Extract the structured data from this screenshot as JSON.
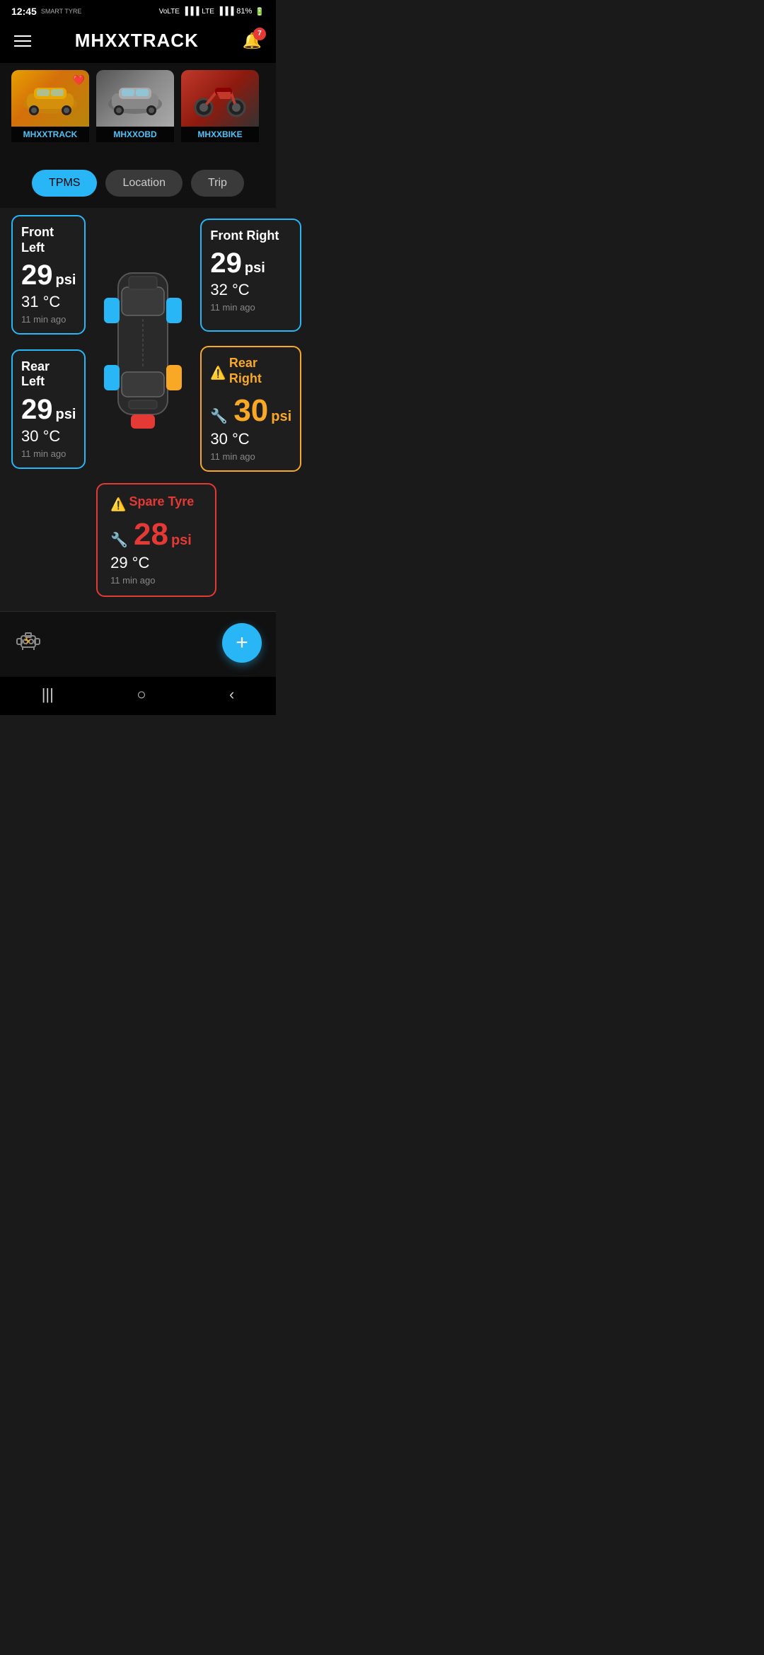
{
  "statusBar": {
    "time": "12:45",
    "brand": "SMART TYRE",
    "signal1": "VoLTE1",
    "signal2": "VoLTE2",
    "battery": "81%"
  },
  "header": {
    "title": "MHXXTRACK",
    "notificationCount": "7"
  },
  "vehicles": [
    {
      "id": "v1",
      "name": "MHXXTRACK",
      "type": "car-yellow",
      "favorited": true
    },
    {
      "id": "v2",
      "name": "MHXXOBD",
      "type": "car-white",
      "favorited": false
    },
    {
      "id": "v3",
      "name": "MHXXBIKE",
      "type": "car-bike",
      "favorited": false
    }
  ],
  "tabs": [
    {
      "id": "tpms",
      "label": "TPMS",
      "active": true
    },
    {
      "id": "location",
      "label": "Location",
      "active": false
    },
    {
      "id": "trip",
      "label": "Trip",
      "active": false
    }
  ],
  "tires": {
    "frontLeft": {
      "label": "Front Left",
      "psi": "29",
      "psiUnit": "psi",
      "temp": "31 °C",
      "time": "11 min ago",
      "status": "normal"
    },
    "frontRight": {
      "label": "Front Right",
      "psi": "29",
      "psiUnit": "psi",
      "temp": "32 °C",
      "time": "11 min ago",
      "status": "normal"
    },
    "rearLeft": {
      "label": "Rear Left",
      "psi": "29",
      "psiUnit": "psi",
      "temp": "30 °C",
      "time": "11 min ago",
      "status": "normal"
    },
    "rearRight": {
      "label": "Rear Right",
      "psi": "30",
      "psiUnit": "psi",
      "temp": "30 °C",
      "time": "11 min ago",
      "status": "warning"
    },
    "spare": {
      "label": "Spare Tyre",
      "psi": "28",
      "psiUnit": "psi",
      "temp": "29 °C",
      "time": "11 min ago",
      "status": "danger"
    }
  },
  "fab": {
    "label": "+"
  },
  "nav": {
    "items": [
      "|||",
      "○",
      "<"
    ]
  }
}
